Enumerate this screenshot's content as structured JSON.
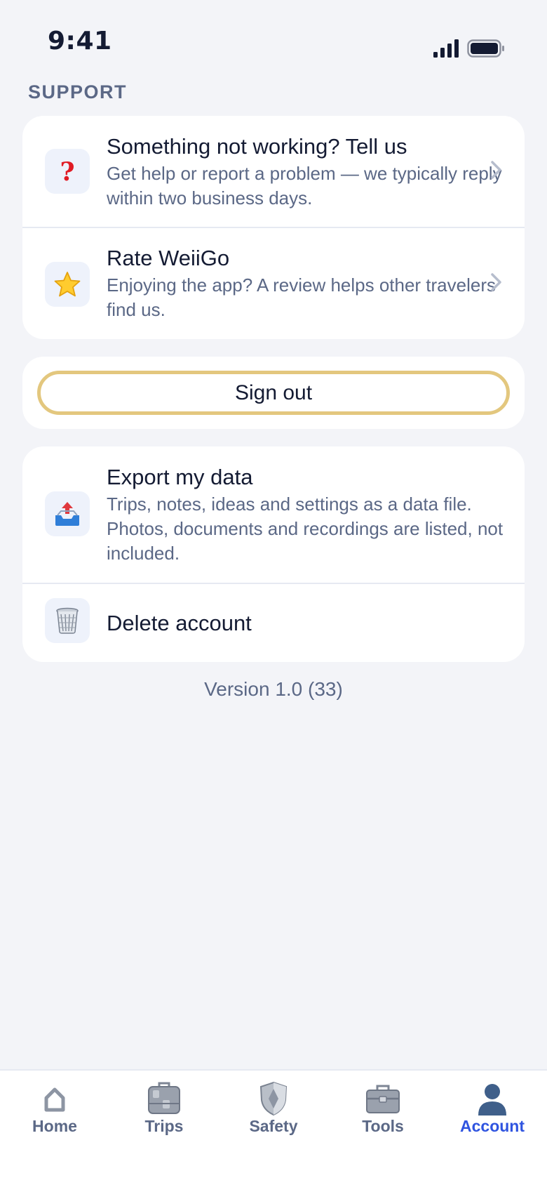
{
  "status_bar": {
    "time": "9:41"
  },
  "support": {
    "section_title": "SUPPORT",
    "items": [
      {
        "icon": "question-icon",
        "title": "Something not working? Tell us",
        "description": "Get help or report a problem — we typically reply within two business days."
      },
      {
        "icon": "star-icon",
        "title": "Rate WeiiGo",
        "description": "Enjoying the app? A review helps other travelers find us."
      }
    ]
  },
  "sign_out": {
    "label": "Sign out",
    "accent_color": "#e3c77e"
  },
  "data_section": {
    "items": [
      {
        "icon": "outbox-tray-icon",
        "title": "Export my data",
        "description": "Trips, notes, ideas and settings as a data file. Photos, documents and recordings are listed, not included."
      },
      {
        "icon": "trash-icon",
        "title": "Delete account"
      }
    ]
  },
  "version": "Version 1.0 (33)",
  "tab_bar": {
    "active_color": "#2f54e0",
    "tabs": [
      {
        "label": "Home",
        "icon": "home-icon",
        "active": false
      },
      {
        "label": "Trips",
        "icon": "luggage-icon",
        "active": false
      },
      {
        "label": "Safety",
        "icon": "shield-icon",
        "active": false
      },
      {
        "label": "Tools",
        "icon": "toolbox-icon",
        "active": false
      },
      {
        "label": "Account",
        "icon": "person-icon",
        "active": true
      }
    ]
  }
}
